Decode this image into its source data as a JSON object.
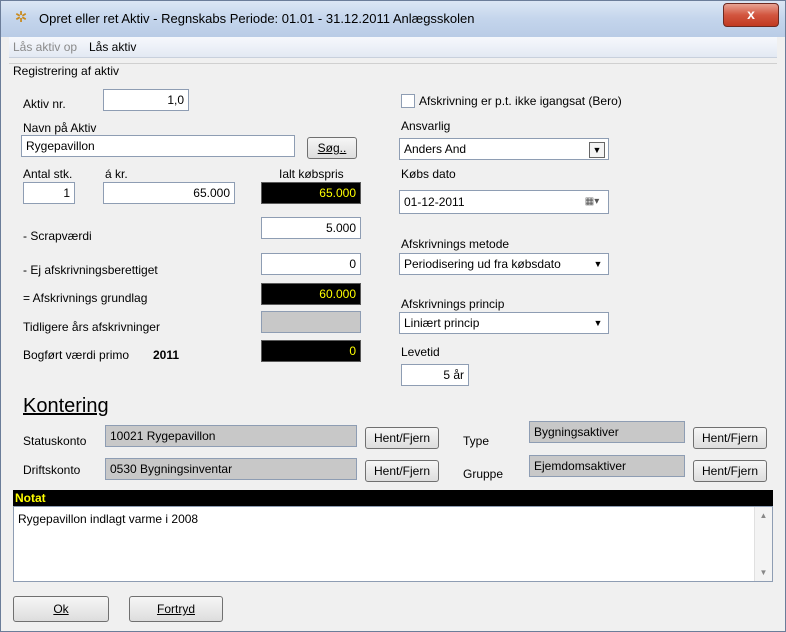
{
  "window": {
    "title": "Opret eller ret Aktiv - Regnskabs Periode: 01.01 - 31.12.2011 Anlægsskolen",
    "close_label": "x"
  },
  "menu": {
    "unlock": "Lås aktiv op",
    "lock": "Lås aktiv"
  },
  "registration": {
    "group_title": "Registrering af aktiv",
    "aktiv_nr_label": "Aktiv nr.",
    "aktiv_nr_value": "1,0",
    "navn_label": "Navn på Aktiv",
    "navn_value": "Rygepavillon",
    "sog_button": "Søg..",
    "antal_label": "Antal stk.",
    "antal_value": "1",
    "akr_label": "á kr.",
    "akr_value": "65.000",
    "ialt_label": "Ialt købspris",
    "ialt_value": "65.000",
    "scrap_label": "- Scrapværdi",
    "scrap_value": "5.000",
    "ej_label": "- Ej afskrivningsberettiget",
    "ej_value": "0",
    "grundlag_label": "= Afskrivnings grundlag",
    "grundlag_value": "60.000",
    "tidligere_label": "Tidligere års afskrivninger",
    "tidligere_value": "",
    "bogfort_label": "Bogført værdi primo",
    "bogfort_year": "2011",
    "bogfort_value": "0"
  },
  "right_panel": {
    "bero_label": "Afskrivning er p.t. ikke igangsat (Bero)",
    "bero_checked": false,
    "ansvarlig_label": "Ansvarlig",
    "ansvarlig_value": "Anders And",
    "kobsdato_label": "Købs dato",
    "kobsdato_value": "01-12-2011",
    "metode_label": "Afskrivnings metode",
    "metode_value": "Periodisering ud fra købsdato",
    "princip_label": "Afskrivnings princip",
    "princip_value": "Liniært princip",
    "levetid_label": "Levetid",
    "levetid_value": "5 år"
  },
  "kontering": {
    "title": "Kontering",
    "statuskonto_label": "Statuskonto",
    "statuskonto_value": "10021 Rygepavillon",
    "driftskonto_label": "Driftskonto",
    "driftskonto_value": "0530 Bygningsinventar",
    "type_label": "Type",
    "type_value": "Bygningsaktiver",
    "gruppe_label": "Gruppe",
    "gruppe_value": "Ejemdomsaktiver",
    "hent_fjern": "Hent/Fjern"
  },
  "notat": {
    "label": "Notat",
    "text": "Rygepavillon indlagt varme i 2008"
  },
  "buttons": {
    "ok": "Ok",
    "fortryd": "Fortryd"
  }
}
